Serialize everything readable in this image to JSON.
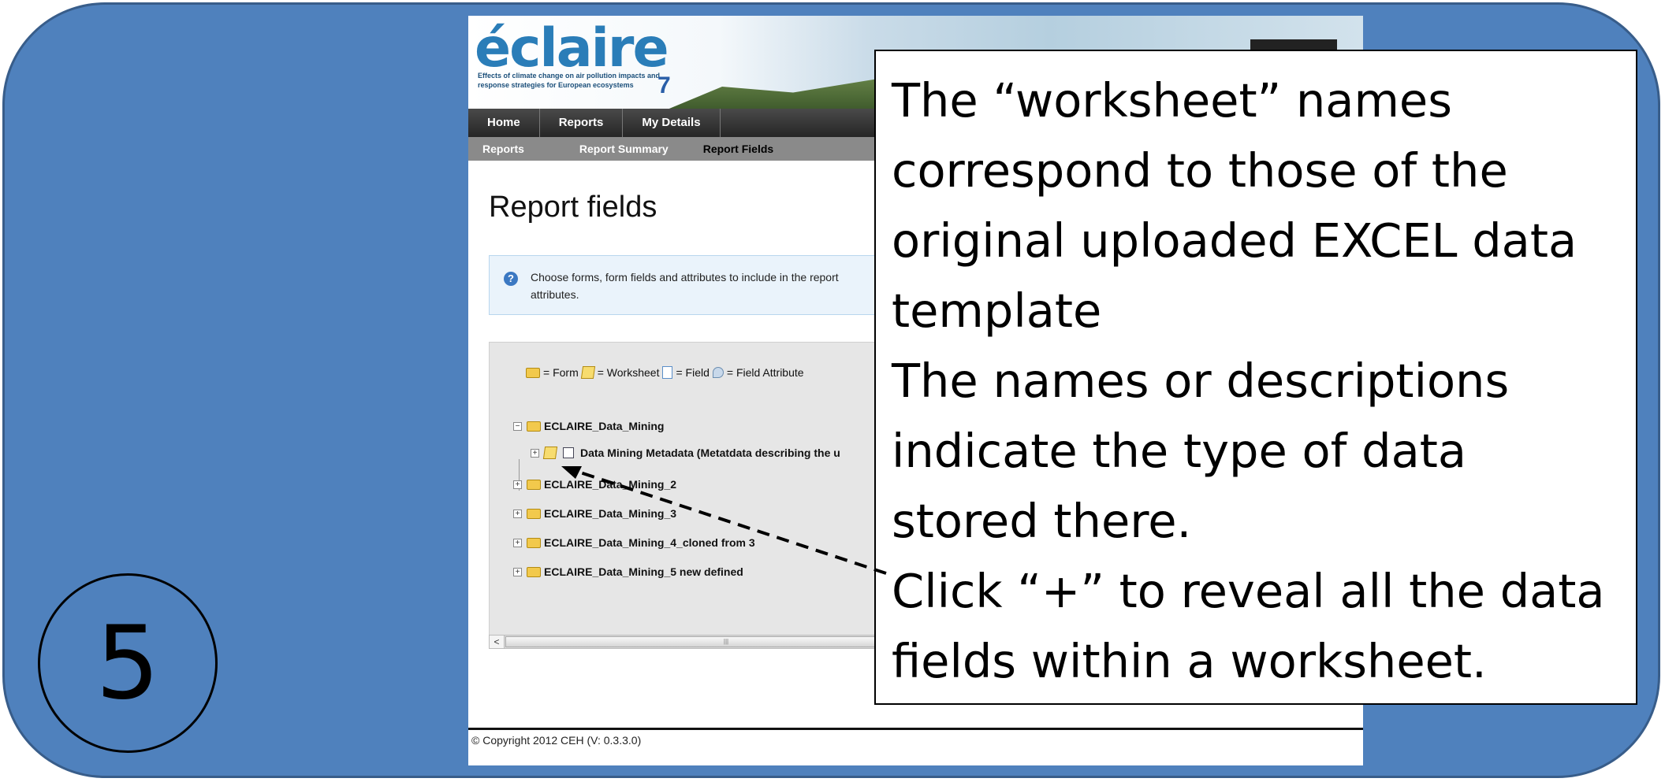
{
  "step_number": "5",
  "app": {
    "logo_text": "éclaire",
    "logo_tagline": "Effects of climate change on air pollution impacts and response strategies for European ecosystems",
    "fp7_badge": "7"
  },
  "nav": {
    "items": [
      {
        "label": "Home"
      },
      {
        "label": "Reports"
      },
      {
        "label": "My Details"
      }
    ]
  },
  "subnav": {
    "items": [
      {
        "label": "Reports",
        "active": false
      },
      {
        "label": "Report Summary",
        "active": false
      },
      {
        "label": "Report Fields",
        "active": true
      }
    ]
  },
  "page": {
    "title": "Report fields",
    "info_text": "Choose forms, form fields and attributes to include in the report",
    "info_text_line2": "attributes."
  },
  "legend": {
    "form": "= Form",
    "worksheet": "= Worksheet",
    "field": "= Field",
    "field_attribute": "= Field Attribute"
  },
  "tree": {
    "items": [
      {
        "label": "ECLAIRE_Data_Mining",
        "expander": "−"
      },
      {
        "label": "Data Mining Metadata (Metatdata describing the u",
        "expander": "+"
      },
      {
        "label": "ECLAIRE_Data_Mining_2",
        "expander": "+"
      },
      {
        "label": "ECLAIRE_Data_Mining_3",
        "expander": "+"
      },
      {
        "label": "ECLAIRE_Data_Mining_4_cloned from 3",
        "expander": "+"
      },
      {
        "label": "ECLAIRE_Data_Mining_5 new defined",
        "expander": "+"
      }
    ]
  },
  "scrollbar": {
    "left_arrow": "<",
    "thumb_grip": "|||"
  },
  "footer": {
    "copyright": "© Copyright 2012 CEH  (V: 0.3.3.0)"
  },
  "callout": {
    "lines": [
      "The “worksheet” names",
      "correspond to those of the",
      "original uploaded EXCEL data",
      "template",
      "The names or descriptions",
      "indicate the type of data",
      "stored there.",
      "Click “+” to reveal all the data",
      "fields within a worksheet."
    ]
  },
  "colors": {
    "slide_background": "#4f81bd",
    "nav_bar": "#333333",
    "subnav_bar": "#8a8a8a",
    "info_box": "#eaf3fb",
    "tree_panel": "#e6e6e6"
  }
}
